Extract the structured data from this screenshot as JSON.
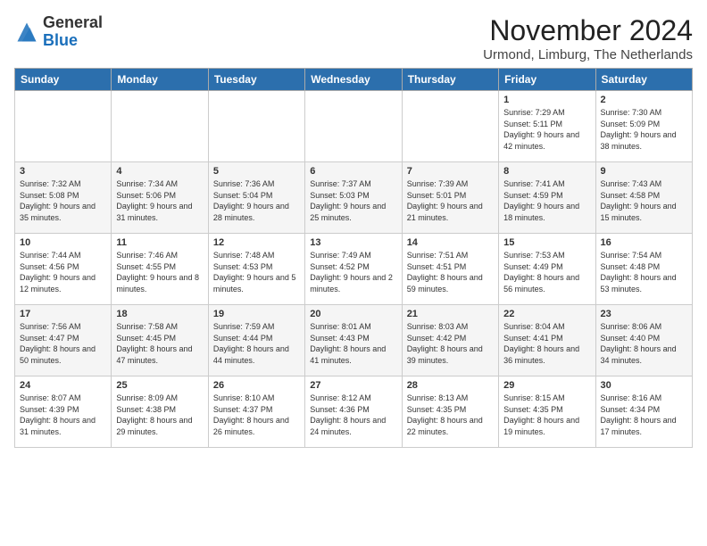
{
  "header": {
    "logo_general": "General",
    "logo_blue": "Blue",
    "month_title": "November 2024",
    "location": "Urmond, Limburg, The Netherlands"
  },
  "weekdays": [
    "Sunday",
    "Monday",
    "Tuesday",
    "Wednesday",
    "Thursday",
    "Friday",
    "Saturday"
  ],
  "weeks": [
    [
      {
        "day": "",
        "info": ""
      },
      {
        "day": "",
        "info": ""
      },
      {
        "day": "",
        "info": ""
      },
      {
        "day": "",
        "info": ""
      },
      {
        "day": "",
        "info": ""
      },
      {
        "day": "1",
        "info": "Sunrise: 7:29 AM\nSunset: 5:11 PM\nDaylight: 9 hours and 42 minutes."
      },
      {
        "day": "2",
        "info": "Sunrise: 7:30 AM\nSunset: 5:09 PM\nDaylight: 9 hours and 38 minutes."
      }
    ],
    [
      {
        "day": "3",
        "info": "Sunrise: 7:32 AM\nSunset: 5:08 PM\nDaylight: 9 hours and 35 minutes."
      },
      {
        "day": "4",
        "info": "Sunrise: 7:34 AM\nSunset: 5:06 PM\nDaylight: 9 hours and 31 minutes."
      },
      {
        "day": "5",
        "info": "Sunrise: 7:36 AM\nSunset: 5:04 PM\nDaylight: 9 hours and 28 minutes."
      },
      {
        "day": "6",
        "info": "Sunrise: 7:37 AM\nSunset: 5:03 PM\nDaylight: 9 hours and 25 minutes."
      },
      {
        "day": "7",
        "info": "Sunrise: 7:39 AM\nSunset: 5:01 PM\nDaylight: 9 hours and 21 minutes."
      },
      {
        "day": "8",
        "info": "Sunrise: 7:41 AM\nSunset: 4:59 PM\nDaylight: 9 hours and 18 minutes."
      },
      {
        "day": "9",
        "info": "Sunrise: 7:43 AM\nSunset: 4:58 PM\nDaylight: 9 hours and 15 minutes."
      }
    ],
    [
      {
        "day": "10",
        "info": "Sunrise: 7:44 AM\nSunset: 4:56 PM\nDaylight: 9 hours and 12 minutes."
      },
      {
        "day": "11",
        "info": "Sunrise: 7:46 AM\nSunset: 4:55 PM\nDaylight: 9 hours and 8 minutes."
      },
      {
        "day": "12",
        "info": "Sunrise: 7:48 AM\nSunset: 4:53 PM\nDaylight: 9 hours and 5 minutes."
      },
      {
        "day": "13",
        "info": "Sunrise: 7:49 AM\nSunset: 4:52 PM\nDaylight: 9 hours and 2 minutes."
      },
      {
        "day": "14",
        "info": "Sunrise: 7:51 AM\nSunset: 4:51 PM\nDaylight: 8 hours and 59 minutes."
      },
      {
        "day": "15",
        "info": "Sunrise: 7:53 AM\nSunset: 4:49 PM\nDaylight: 8 hours and 56 minutes."
      },
      {
        "day": "16",
        "info": "Sunrise: 7:54 AM\nSunset: 4:48 PM\nDaylight: 8 hours and 53 minutes."
      }
    ],
    [
      {
        "day": "17",
        "info": "Sunrise: 7:56 AM\nSunset: 4:47 PM\nDaylight: 8 hours and 50 minutes."
      },
      {
        "day": "18",
        "info": "Sunrise: 7:58 AM\nSunset: 4:45 PM\nDaylight: 8 hours and 47 minutes."
      },
      {
        "day": "19",
        "info": "Sunrise: 7:59 AM\nSunset: 4:44 PM\nDaylight: 8 hours and 44 minutes."
      },
      {
        "day": "20",
        "info": "Sunrise: 8:01 AM\nSunset: 4:43 PM\nDaylight: 8 hours and 41 minutes."
      },
      {
        "day": "21",
        "info": "Sunrise: 8:03 AM\nSunset: 4:42 PM\nDaylight: 8 hours and 39 minutes."
      },
      {
        "day": "22",
        "info": "Sunrise: 8:04 AM\nSunset: 4:41 PM\nDaylight: 8 hours and 36 minutes."
      },
      {
        "day": "23",
        "info": "Sunrise: 8:06 AM\nSunset: 4:40 PM\nDaylight: 8 hours and 34 minutes."
      }
    ],
    [
      {
        "day": "24",
        "info": "Sunrise: 8:07 AM\nSunset: 4:39 PM\nDaylight: 8 hours and 31 minutes."
      },
      {
        "day": "25",
        "info": "Sunrise: 8:09 AM\nSunset: 4:38 PM\nDaylight: 8 hours and 29 minutes."
      },
      {
        "day": "26",
        "info": "Sunrise: 8:10 AM\nSunset: 4:37 PM\nDaylight: 8 hours and 26 minutes."
      },
      {
        "day": "27",
        "info": "Sunrise: 8:12 AM\nSunset: 4:36 PM\nDaylight: 8 hours and 24 minutes."
      },
      {
        "day": "28",
        "info": "Sunrise: 8:13 AM\nSunset: 4:35 PM\nDaylight: 8 hours and 22 minutes."
      },
      {
        "day": "29",
        "info": "Sunrise: 8:15 AM\nSunset: 4:35 PM\nDaylight: 8 hours and 19 minutes."
      },
      {
        "day": "30",
        "info": "Sunrise: 8:16 AM\nSunset: 4:34 PM\nDaylight: 8 hours and 17 minutes."
      }
    ]
  ]
}
